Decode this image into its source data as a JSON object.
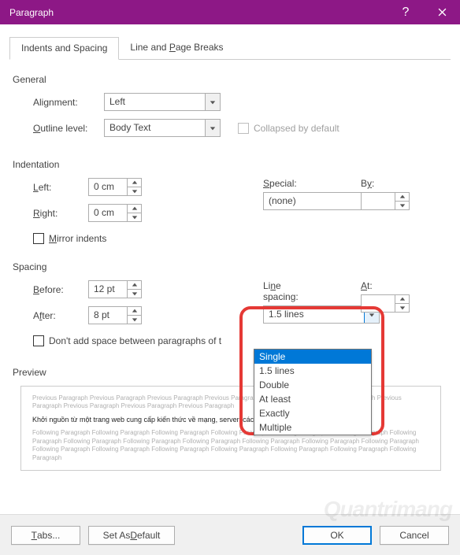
{
  "title": "Paragraph",
  "tabs": {
    "indents": "Indents and Spacing",
    "linepage": "Line and Page Breaks"
  },
  "general": {
    "title": "General",
    "alignment_label": "Alignment:",
    "alignment_value": "Left",
    "outline_label": "Outline level:",
    "outline_value": "Body Text",
    "collapsed_label": "Collapsed by default"
  },
  "indentation": {
    "title": "Indentation",
    "left_label": "Left:",
    "left_value": "0 cm",
    "right_label": "Right:",
    "right_value": "0 cm",
    "special_label": "Special:",
    "special_value": "(none)",
    "by_label": "By:",
    "by_value": "",
    "mirror_label": "Mirror indents"
  },
  "spacing": {
    "title": "Spacing",
    "before_label": "Before:",
    "before_value": "12 pt",
    "after_label": "After:",
    "after_value": "8 pt",
    "line_label": "Line spacing:",
    "line_value": "1.5 lines",
    "at_label": "At:",
    "at_value": "",
    "dontadd_label": "Don't add space between paragraphs of t",
    "options": [
      "Single",
      "1.5 lines",
      "Double",
      "At least",
      "Exactly",
      "Multiple"
    ]
  },
  "preview": {
    "title": "Preview",
    "before_text": "Previous Paragraph Previous Paragraph Previous Paragraph Previous Paragraph Previous Paragraph Previous Paragraph Previous Paragraph Previous Paragraph Previous Paragraph Previous Paragraph",
    "active_text": "Khởi nguồn từ một trang web cung cấp kiến thức về mạng, server, các thiết bị mạng, thủ thuật máy tính.",
    "after_text": "Following Paragraph Following Paragraph Following Paragraph Following Paragraph Following Paragraph Following Paragraph Following Paragraph Following Paragraph Following Paragraph Following Paragraph Following Paragraph Following Paragraph Following Paragraph Following Paragraph Following Paragraph Following Paragraph Following Paragraph Following Paragraph Following Paragraph Following Paragraph"
  },
  "footer": {
    "tabs": "Tabs...",
    "default": "Set As Default",
    "ok": "OK",
    "cancel": "Cancel"
  },
  "watermark": "Quantrimang"
}
